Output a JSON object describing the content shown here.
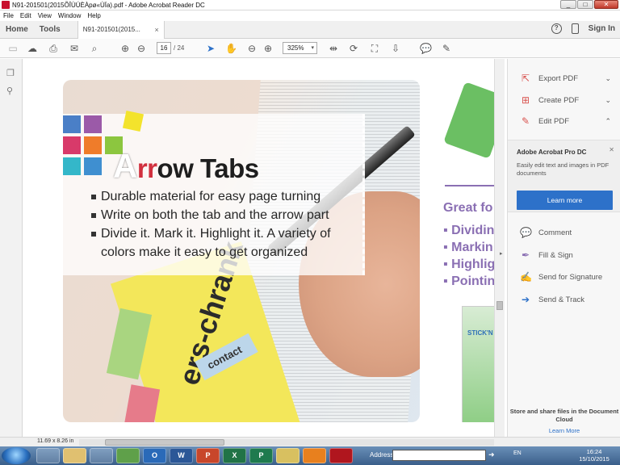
{
  "window": {
    "title": "N91-201501(2015ÕÎÙÚÈÀpø«ÙÏa).pdf - Adobe Acrobat Reader DC",
    "controls": [
      "_",
      "□",
      "✕"
    ]
  },
  "menu": [
    "File",
    "Edit",
    "View",
    "Window",
    "Help"
  ],
  "tabs": {
    "home": "Home",
    "tools": "Tools",
    "document": "N91-201501(2015...",
    "close": "×",
    "help_glyph": "?",
    "sign_in": "Sign In"
  },
  "toolbar": {
    "page_current": "16",
    "page_total": "/ 24",
    "zoom": "325%",
    "zoom_dropdown": "▾"
  },
  "document": {
    "page1": {
      "title_first_letter": "A",
      "title_rr": "rr",
      "title_rest": "ow Tabs",
      "bullets": [
        "Durable material  for easy page turning",
        "Write on both the tab and the arrow part",
        "Divide it. Mark it. Highlight it. A variety of",
        "colors make it easy to get organized"
      ],
      "tab_word": "contact",
      "rotated_word": "ers-chrank"
    },
    "page2": {
      "heading": "Great fo",
      "items": [
        "▪ Dividin",
        "▪ Markin",
        "▪ Highlig",
        "▪ Pointin"
      ],
      "pack_label": "STICK'N"
    }
  },
  "right_panel": {
    "items": [
      {
        "label": "Export PDF",
        "icon": "export-pdf-icon",
        "chevron": "⌄"
      },
      {
        "label": "Create PDF",
        "icon": "create-pdf-icon",
        "chevron": "⌄"
      },
      {
        "label": "Edit PDF",
        "icon": "edit-pdf-icon",
        "chevron": "⌃"
      }
    ],
    "promo": {
      "title": "Adobe Acrobat Pro DC",
      "description": "Easily edit text and images in PDF documents",
      "button": "Learn more"
    },
    "tools": [
      {
        "label": "Comment",
        "icon": "comment-icon"
      },
      {
        "label": "Fill & Sign",
        "icon": "fill-sign-icon"
      },
      {
        "label": "Send for Signature",
        "icon": "send-signature-icon"
      },
      {
        "label": "Send & Track",
        "icon": "send-track-icon"
      }
    ],
    "store_text": "Store and share files in the Document Cloud",
    "learn_more": "Learn More"
  },
  "status": {
    "page_size": "11.69 x 8.26 in"
  },
  "taskbar": {
    "apps": [
      "",
      "",
      "",
      "",
      "O",
      "W",
      "P",
      "X",
      "P",
      "",
      "",
      ""
    ],
    "address_label": "Address",
    "language": "EN",
    "time": "16:24",
    "date": "15/10/2015"
  },
  "colors": {
    "accent": "#2d71c9",
    "title_red": "#d1303e",
    "purple": "#8a6fb3"
  }
}
